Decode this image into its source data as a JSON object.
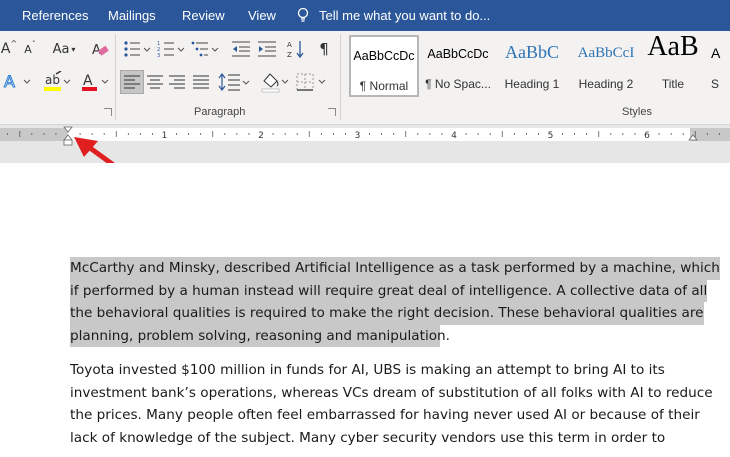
{
  "tabs": [
    "References",
    "Mailings",
    "Review",
    "View"
  ],
  "tell_me": "Tell me what you want to do...",
  "ribbon": {
    "font_buttons": {
      "font_size_case": "Aa"
    },
    "paragraph_label": "Paragraph",
    "styles_label": "Styles",
    "styles": [
      {
        "preview": "AaBbCcDc",
        "name": "¶ Normal"
      },
      {
        "preview": "AaBbCcDc",
        "name": "¶ No Spac..."
      },
      {
        "preview": "AaBbC",
        "name": "Heading 1"
      },
      {
        "preview": "AaBbCcI",
        "name": "Heading 2"
      },
      {
        "preview": "AaB",
        "name": "Title"
      },
      {
        "preview": "A",
        "name": "S"
      }
    ]
  },
  "ruler": {
    "numbers": [
      "1",
      "2",
      "3",
      "4",
      "5",
      "6"
    ]
  },
  "colors": {
    "title_bar": "#2b579a",
    "highlight_yellow": "#ffff00",
    "font_red": "#e81123",
    "arrow_red": "#e02020",
    "selection": "#c8c8c8"
  },
  "document": {
    "para1_lines": [
      "McCarthy and Minsky, described Artificial Intelligence as a task performed by a machine, which",
      "if performed by a human instead will require great deal of intelligence. A collective data of all",
      "the behavioral qualities is required to make the right decision. These behavioral qualities are",
      "planning, problem solving, reasoning and manipulation."
    ],
    "para2_lines": [
      "Toyota invested $100 million in funds for AI, UBS is making an attempt to bring AI to its",
      "investment bank’s operations, whereas VCs dream of substitution of all folks with AI to reduce",
      "the prices. Many people often feel embarrassed for having never used AI or because of their",
      "lack of knowledge of the subject. Many cyber security vendors use this term in order to"
    ]
  }
}
